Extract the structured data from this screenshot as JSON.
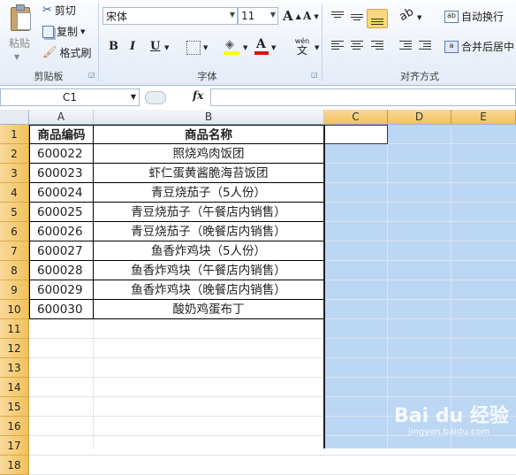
{
  "ribbon": {
    "clipboard": {
      "paste": "粘贴",
      "cut": "剪切",
      "copy": "复制",
      "format_painter": "格式刷",
      "group_label": "剪贴板"
    },
    "font": {
      "font_name": "宋体",
      "font_size": "11",
      "bold": "B",
      "italic": "I",
      "underline": "U",
      "font_color_letter": "A",
      "phonetic": "wén",
      "group_label": "字体"
    },
    "alignment": {
      "wrap_text": "自动换行",
      "merge_center": "合并后居中",
      "group_label": "对齐方式"
    }
  },
  "formula_bar": {
    "name_box": "C1",
    "fx": "fx",
    "content": ""
  },
  "columns": [
    "A",
    "B",
    "C",
    "D",
    "E"
  ],
  "rows": [
    "1",
    "2",
    "3",
    "4",
    "5",
    "6",
    "7",
    "8",
    "9",
    "10",
    "11",
    "12",
    "13",
    "14",
    "15",
    "16",
    "17",
    "18"
  ],
  "table": {
    "headers": [
      "商品编码",
      "商品名称"
    ],
    "rows": [
      [
        "600022",
        "照烧鸡肉饭团"
      ],
      [
        "600023",
        "虾仁蛋黄酱脆海苔饭团"
      ],
      [
        "600024",
        "青豆烧茄子（5人份）"
      ],
      [
        "600025",
        "青豆烧茄子（午餐店内销售）"
      ],
      [
        "600026",
        "青豆烧茄子（晚餐店内销售）"
      ],
      [
        "600027",
        "鱼香炸鸡块（5人份）"
      ],
      [
        "600028",
        "鱼香炸鸡块（午餐店内销售）"
      ],
      [
        "600029",
        "鱼香炸鸡块（晚餐店内销售）"
      ],
      [
        "600030",
        "酸奶鸡蛋布丁"
      ]
    ]
  },
  "watermark": {
    "brand": "Bai du 经验",
    "url": "jingyan.baidu.com"
  },
  "colors": {
    "selection": "#bcd7f3",
    "header_selected": "#f1c25b",
    "ribbon_bg": "#e3ebf6"
  }
}
